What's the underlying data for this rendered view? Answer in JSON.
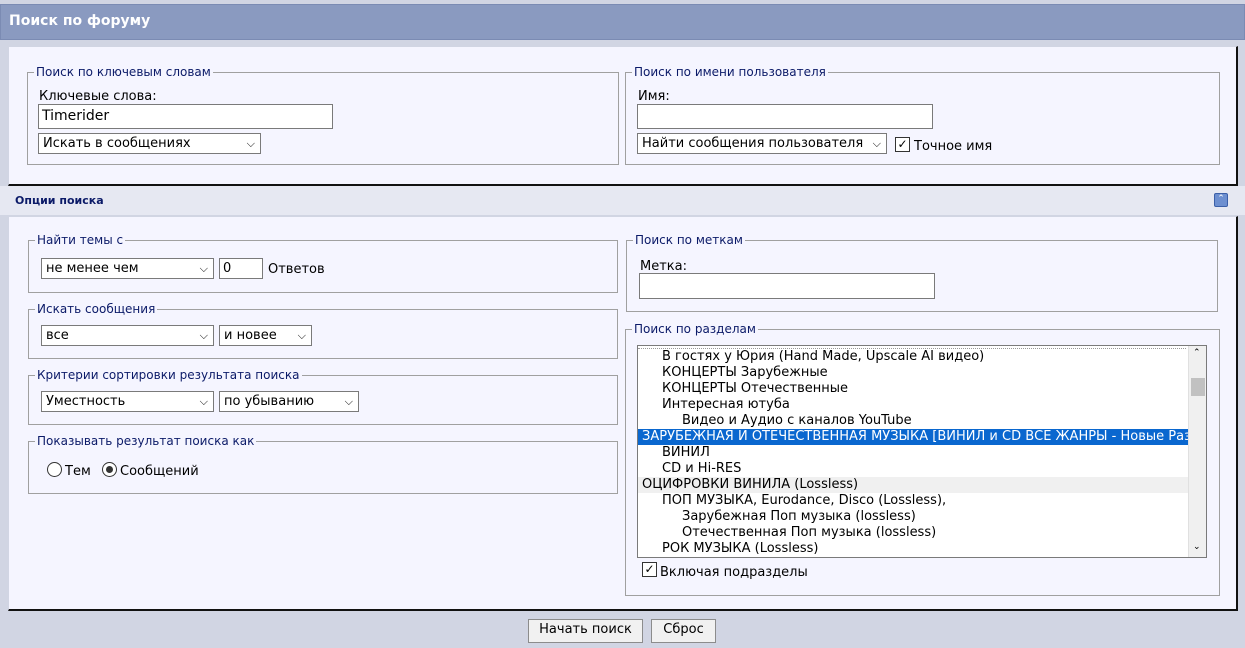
{
  "page": {
    "title": "Поиск по форуму"
  },
  "keywords": {
    "legend": "Поиск по ключевым словам",
    "label": "Ключевые слова:",
    "value": "Timerider",
    "scope": "Искать в сообщениях"
  },
  "user": {
    "legend": "Поиск по имени пользователя",
    "label": "Имя:",
    "value": "",
    "mode": "Найти сообщения пользователя",
    "exact_label": "Точное имя",
    "exact_checked": true
  },
  "options": {
    "title": "Опции поиска"
  },
  "threads": {
    "legend": "Найти темы с",
    "mode": "не менее чем",
    "count": "0",
    "unit": "Ответов"
  },
  "posts": {
    "legend": "Искать сообщения",
    "period": "все",
    "direction": "и новее"
  },
  "sort": {
    "legend": "Критерии сортировки результата поиска",
    "field": "Уместность",
    "order": "по убыванию"
  },
  "display": {
    "legend": "Показывать результат поиска как",
    "threads_label": "Тем",
    "posts_label": "Сообщений",
    "selected": "posts"
  },
  "tags": {
    "legend": "Поиск по меткам",
    "label": "Метка:",
    "value": ""
  },
  "sections": {
    "legend": "Поиск по разделам",
    "items": [
      {
        "label": "В гостях у Юрия (Hand Made, Upscale AI видео)",
        "level": 1,
        "selected": false,
        "gray": false
      },
      {
        "label": "КОНЦЕРТЫ Зарубежные",
        "level": 1,
        "selected": false,
        "gray": false
      },
      {
        "label": "КОНЦЕРТЫ Отечественные",
        "level": 1,
        "selected": false,
        "gray": false
      },
      {
        "label": "Интересная ютуба",
        "level": 1,
        "selected": false,
        "gray": false
      },
      {
        "label": "Видео и Аудио с каналов YouTube",
        "level": 2,
        "selected": false,
        "gray": false
      },
      {
        "label": "ЗАРУБЕЖНАЯ И ОТЕЧЕСТВЕННАЯ МУЗЫКА [ВИНИЛ и CD ВСЕ ЖАНРЫ - Новые Раз",
        "level": 0,
        "selected": true,
        "gray": false
      },
      {
        "label": "ВИНИЛ",
        "level": 1,
        "selected": false,
        "gray": false
      },
      {
        "label": "CD и Hi-RES",
        "level": 1,
        "selected": false,
        "gray": false
      },
      {
        "label": "ОЦИФРОВКИ ВИНИЛА (Lossless)",
        "level": 0,
        "selected": false,
        "gray": true
      },
      {
        "label": "ПОП МУЗЫКА, Eurodance, Disco (Lossless),",
        "level": 1,
        "selected": false,
        "gray": false
      },
      {
        "label": "Зарубежная Поп музыка (lossless)",
        "level": 2,
        "selected": false,
        "gray": false
      },
      {
        "label": "Отечественная Поп музыка (lossless)",
        "level": 2,
        "selected": false,
        "gray": false
      },
      {
        "label": "РОК МУЗЫКА (Lossless)",
        "level": 1,
        "selected": false,
        "gray": false
      }
    ],
    "include_label": "Включая подразделы",
    "include_checked": true
  },
  "actions": {
    "search": "Начать поиск",
    "reset": "Сброс"
  }
}
